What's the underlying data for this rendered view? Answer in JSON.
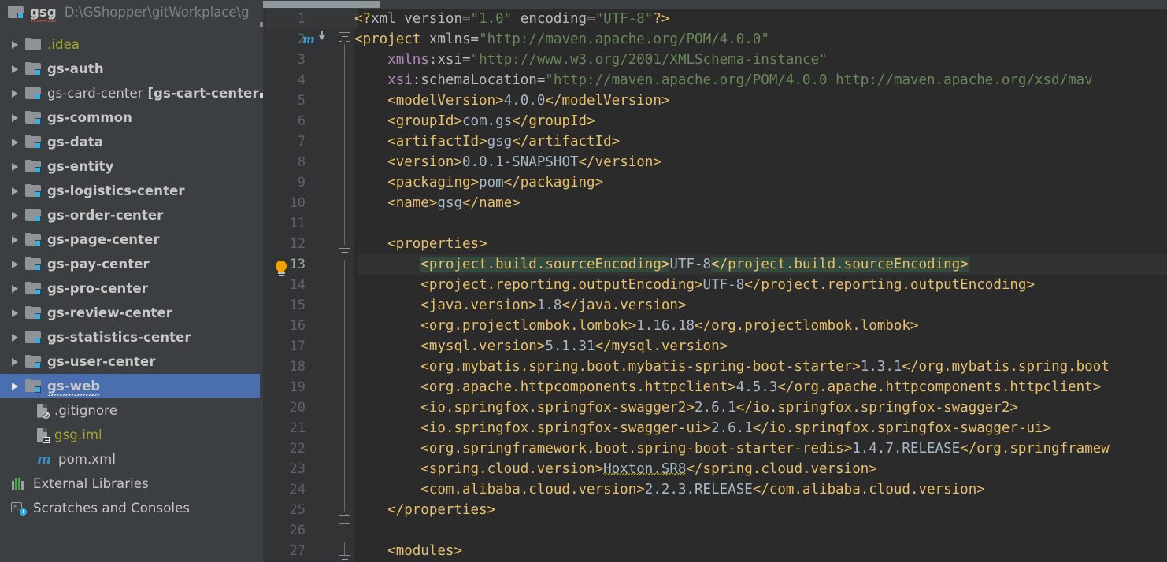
{
  "project_tree": {
    "root": {
      "name": "gsg",
      "path": "D:\\GShopper\\gitWorkplace\\g",
      "icon": "module-folder-icon"
    },
    "items": [
      {
        "label": ".idea",
        "icon": "folder-icon",
        "style": "yellow",
        "expandable": true,
        "level": 1
      },
      {
        "label": "gs-auth",
        "icon": "module-folder-icon",
        "style": "bold",
        "expandable": true,
        "level": 1
      },
      {
        "label": "gs-card-center",
        "suffix": "[gs-cart-center",
        "icon": "module-folder-icon",
        "style": "normal",
        "expandable": true,
        "level": 1
      },
      {
        "label": "gs-common",
        "icon": "module-folder-icon",
        "style": "bold",
        "expandable": true,
        "level": 1
      },
      {
        "label": "gs-data",
        "icon": "module-folder-icon",
        "style": "bold",
        "expandable": true,
        "level": 1
      },
      {
        "label": "gs-entity",
        "icon": "module-folder-icon",
        "style": "bold",
        "expandable": true,
        "level": 1
      },
      {
        "label": "gs-logistics-center",
        "icon": "module-folder-icon",
        "style": "bold",
        "expandable": true,
        "level": 1
      },
      {
        "label": "gs-order-center",
        "icon": "module-folder-icon",
        "style": "bold",
        "expandable": true,
        "level": 1
      },
      {
        "label": "gs-page-center",
        "icon": "module-folder-icon",
        "style": "bold",
        "expandable": true,
        "level": 1
      },
      {
        "label": "gs-pay-center",
        "icon": "module-folder-icon",
        "style": "bold",
        "expandable": true,
        "level": 1
      },
      {
        "label": "gs-pro-center",
        "icon": "module-folder-icon",
        "style": "bold",
        "expandable": true,
        "level": 1
      },
      {
        "label": "gs-review-center",
        "icon": "module-folder-icon",
        "style": "bold",
        "expandable": true,
        "level": 1
      },
      {
        "label": "gs-statistics-center",
        "icon": "module-folder-icon",
        "style": "bold",
        "expandable": true,
        "level": 1
      },
      {
        "label": "gs-user-center",
        "icon": "module-folder-icon",
        "style": "bold",
        "expandable": true,
        "level": 1
      },
      {
        "label": "gs-web",
        "icon": "module-folder-icon",
        "style": "bold",
        "expandable": true,
        "level": 1,
        "selected": true
      },
      {
        "label": ".gitignore",
        "icon": "file-ignored-icon",
        "style": "normal",
        "expandable": false,
        "level": 2
      },
      {
        "label": "gsg.iml",
        "icon": "file-iml-icon",
        "style": "yellow",
        "expandable": false,
        "level": 2
      },
      {
        "label": "pom.xml",
        "icon": "maven-file-icon",
        "style": "normal",
        "expandable": false,
        "level": 2
      },
      {
        "label": "External Libraries",
        "icon": "libraries-icon",
        "style": "normal",
        "expandable": false,
        "level": 0
      },
      {
        "label": "Scratches and Consoles",
        "icon": "scratches-icon",
        "style": "normal",
        "expandable": false,
        "level": 0
      }
    ]
  },
  "editor": {
    "file": "pom.xml",
    "current_line": 13,
    "gutter_icons": [
      {
        "line": 2,
        "icon": "maven-reload-icon"
      },
      {
        "line": 13,
        "icon": "intention-bulb-icon"
      }
    ],
    "fold_markers": [
      {
        "line": 2,
        "type": "open"
      },
      {
        "line": 12,
        "type": "open"
      },
      {
        "line": 25,
        "type": "close"
      }
    ],
    "line_numbers": [
      1,
      2,
      3,
      4,
      5,
      6,
      7,
      8,
      9,
      10,
      11,
      12,
      13,
      14,
      15,
      16,
      17,
      18,
      19,
      20,
      21,
      22,
      23,
      24,
      25,
      26,
      27
    ],
    "lines": [
      {
        "n": 1,
        "text": "<?xml version=\"1.0\" encoding=\"UTF-8\"?>"
      },
      {
        "n": 2,
        "text": "<project xmlns=\"http://maven.apache.org/POM/4.0.0\""
      },
      {
        "n": 3,
        "text": "    xmlns:xsi=\"http://www.w3.org/2001/XMLSchema-instance\""
      },
      {
        "n": 4,
        "text": "    xsi:schemaLocation=\"http://maven.apache.org/POM/4.0.0 http://maven.apache.org/xsd/mav"
      },
      {
        "n": 5,
        "text": "    <modelVersion>4.0.0</modelVersion>"
      },
      {
        "n": 6,
        "text": "    <groupId>com.gs</groupId>"
      },
      {
        "n": 7,
        "text": "    <artifactId>gsg</artifactId>"
      },
      {
        "n": 8,
        "text": "    <version>0.0.1-SNAPSHOT</version>"
      },
      {
        "n": 9,
        "text": "    <packaging>pom</packaging>"
      },
      {
        "n": 10,
        "text": "    <name>gsg</name>"
      },
      {
        "n": 11,
        "text": ""
      },
      {
        "n": 12,
        "text": "    <properties>"
      },
      {
        "n": 13,
        "text": "        <project.build.sourceEncoding>UTF-8</project.build.sourceEncoding>"
      },
      {
        "n": 14,
        "text": "        <project.reporting.outputEncoding>UTF-8</project.reporting.outputEncoding>"
      },
      {
        "n": 15,
        "text": "        <java.version>1.8</java.version>"
      },
      {
        "n": 16,
        "text": "        <org.projectlombok.lombok>1.16.18</org.projectlombok.lombok>"
      },
      {
        "n": 17,
        "text": "        <mysql.version>5.1.31</mysql.version>"
      },
      {
        "n": 18,
        "text": "        <org.mybatis.spring.boot.mybatis-spring-boot-starter>1.3.1</org.mybatis.spring.boot"
      },
      {
        "n": 19,
        "text": "        <org.apache.httpcomponents.httpclient>4.5.3</org.apache.httpcomponents.httpclient>"
      },
      {
        "n": 20,
        "text": "        <io.springfox.springfox-swagger2>2.6.1</io.springfox.springfox-swagger2>"
      },
      {
        "n": 21,
        "text": "        <io.springfox.springfox-swagger-ui>2.6.1</io.springfox.springfox-swagger-ui>"
      },
      {
        "n": 22,
        "text": "        <org.springframework.boot.spring-boot-starter-redis>1.4.7.RELEASE</org.springframew"
      },
      {
        "n": 23,
        "text": "        <spring.cloud.version>Hoxton.SR8</spring.cloud.version>"
      },
      {
        "n": 24,
        "text": "        <com.alibaba.cloud.version>2.2.3.RELEASE</com.alibaba.cloud.version>"
      },
      {
        "n": 25,
        "text": "    </properties>"
      },
      {
        "n": 26,
        "text": ""
      },
      {
        "n": 27,
        "text": "    <modules>"
      }
    ],
    "selection": {
      "line": 13,
      "text": "<project.build.sourceEncoding>UTF-8</project.build.sourceEncoding>"
    },
    "spellcheck_warnings": [
      {
        "line": 23,
        "word": "Hoxton.SR8"
      }
    ]
  },
  "colors": {
    "editor_background": "#2b2b2b",
    "gutter_background": "#313335",
    "sidebar_background": "#3c3f41",
    "selection_blue": "#4b6eaf",
    "tag_yellow": "#e8bf6a",
    "value_blue": "#a9b7c6",
    "string_green": "#6a8759",
    "namespace_purple": "#b389c5",
    "attribute_gray": "#bababa",
    "match_highlight": "#344a41",
    "current_line": "#323232",
    "line_number": "#606366",
    "iml_yellow": "#a5a52a",
    "bulb_orange": "#eda200"
  }
}
